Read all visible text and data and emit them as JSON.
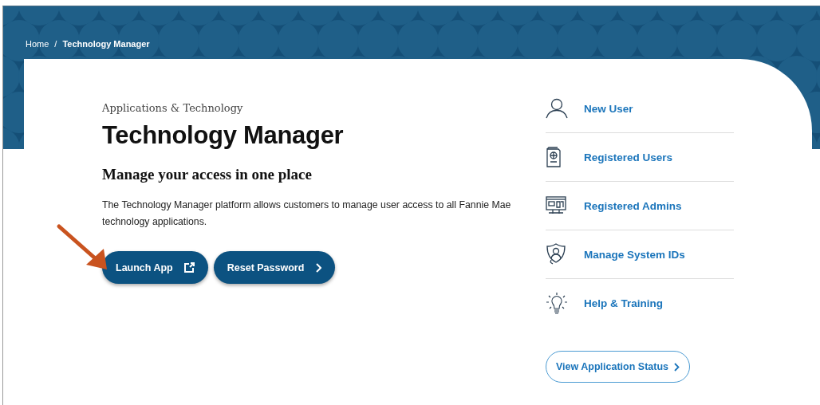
{
  "breadcrumb": [
    {
      "label": "Home",
      "current": false
    },
    {
      "label": "Technology Manager",
      "current": true
    }
  ],
  "breadcrumb_separator": "/",
  "eyebrow": "Applications & Technology",
  "title": "Technology Manager",
  "subtitle": "Manage your access in one place",
  "description": "The Technology Manager platform allows customers to manage user access to all Fannie Mae technology applications.",
  "buttons": [
    {
      "label": "Launch App",
      "kind": "external"
    },
    {
      "label": "Reset Password",
      "kind": "next"
    }
  ],
  "links": [
    {
      "label": "New User",
      "kind": "user"
    },
    {
      "label": "Registered Users",
      "kind": "passport"
    },
    {
      "label": "Registered Admins",
      "kind": "monitor"
    },
    {
      "label": "Manage System IDs",
      "kind": "shield"
    },
    {
      "label": "Help & Training",
      "kind": "bulb"
    }
  ],
  "status_button": {
    "label": "View Application Status"
  }
}
